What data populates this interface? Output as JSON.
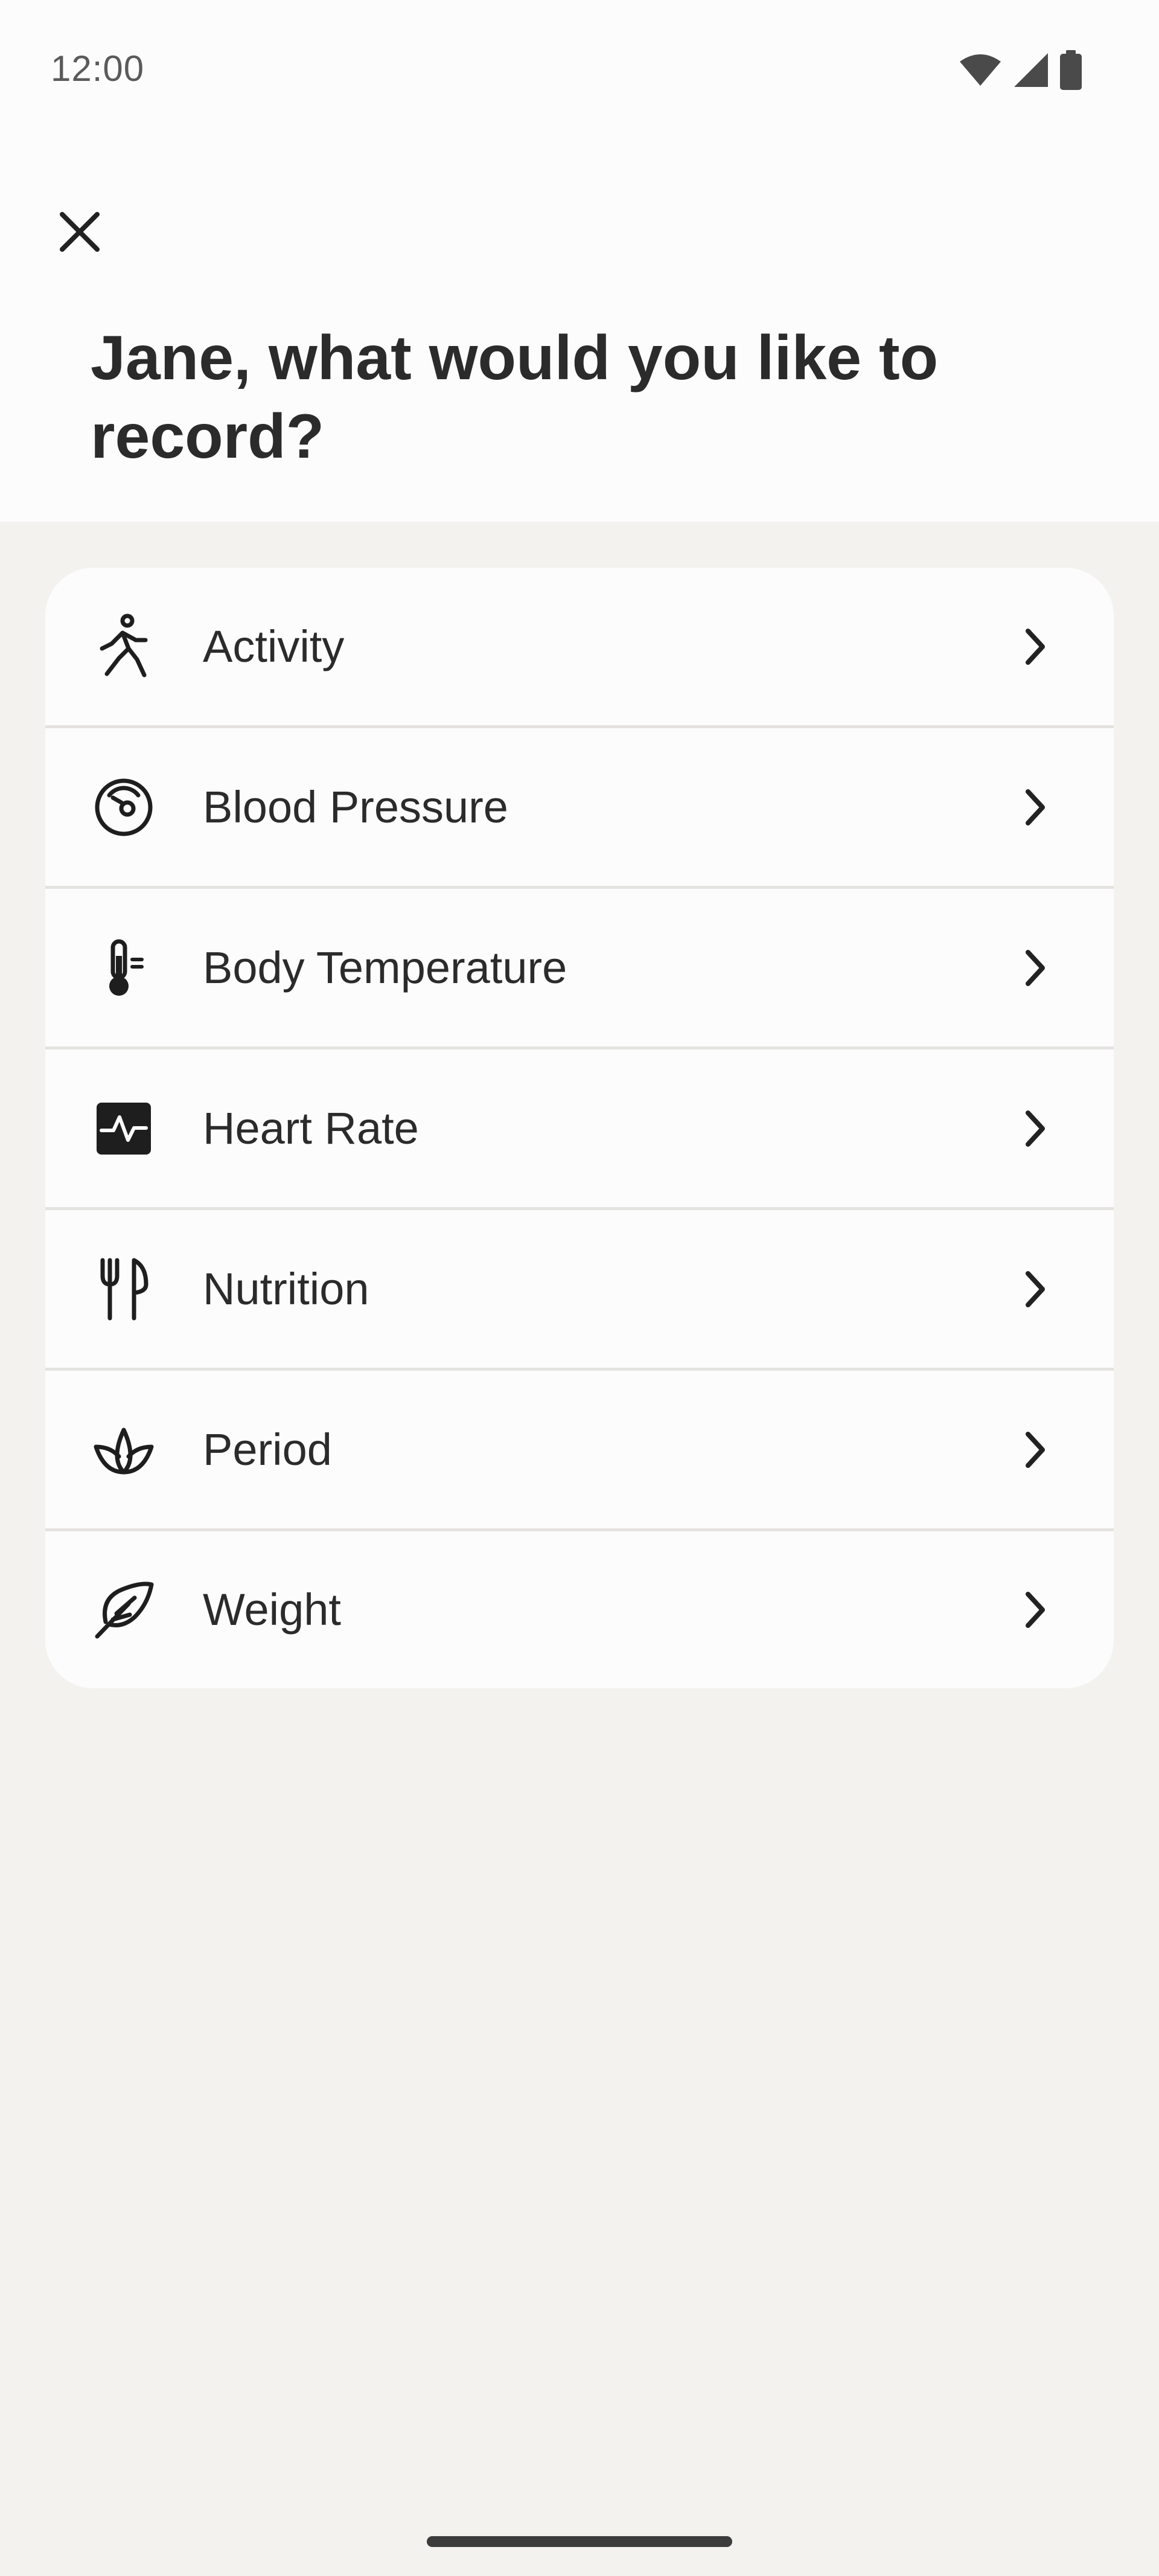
{
  "status_bar": {
    "time": "12:00",
    "icons": [
      "wifi-icon",
      "cellular-signal-icon",
      "battery-icon"
    ]
  },
  "header": {
    "close_icon": "close-icon",
    "title": "Jane, what would you like to record?"
  },
  "options": [
    {
      "label": "Activity",
      "icon": "running-person-icon"
    },
    {
      "label": "Blood Pressure",
      "icon": "gauge-icon"
    },
    {
      "label": "Body Temperature",
      "icon": "thermometer-icon"
    },
    {
      "label": "Heart Rate",
      "icon": "heart-pulse-icon"
    },
    {
      "label": "Nutrition",
      "icon": "fork-knife-icon"
    },
    {
      "label": "Period",
      "icon": "lotus-icon"
    },
    {
      "label": "Weight",
      "icon": "feather-icon"
    }
  ],
  "colors": {
    "background": "#f3f2ef",
    "header_background": "#fcfcfc",
    "card": "#fcfcfc",
    "text": "#2b2b2b",
    "divider": "#e4e3e0"
  }
}
